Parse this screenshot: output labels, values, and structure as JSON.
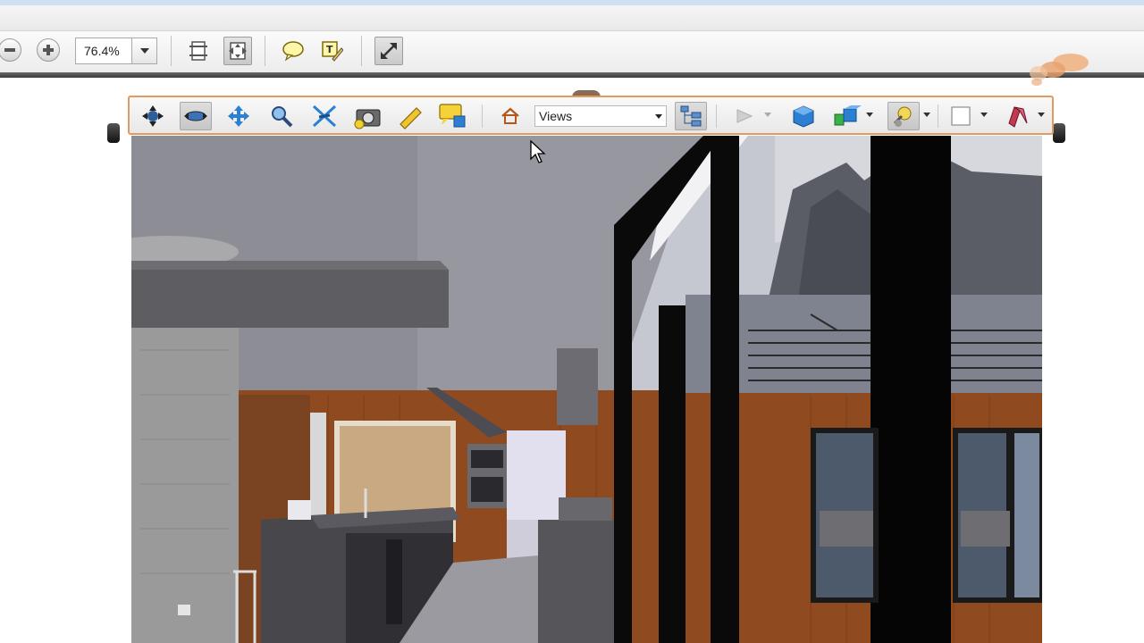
{
  "toolbar": {
    "zoom_value": "76.4%",
    "zoom_out_icon": "zoom-out-icon",
    "zoom_in_icon": "zoom-in-icon",
    "fit_page_icon": "fit-page-icon",
    "fit_width_icon": "fit-width-icon",
    "comment_icon": "sticky-note-icon",
    "highlight_icon": "highlight-text-icon",
    "fullscreen_icon": "fullscreen-icon"
  },
  "toolbar3d": {
    "tools": [
      "rotate-tool-icon",
      "spin-tool-icon",
      "pan-tool-icon",
      "zoom-tool-icon",
      "fly-tool-icon",
      "camera-properties-icon",
      "measure-tool-icon",
      "comment-3d-icon",
      "default-view-icon",
      "model-tree-icon",
      "play-animation-icon",
      "projection-icon",
      "render-mode-icon",
      "lighting-icon",
      "background-color-icon",
      "cross-section-icon"
    ],
    "views_label": "Views"
  },
  "colors": {
    "toolbar_border": "#e29a5e",
    "wood": "#8f4a20",
    "ceiling": "#8e8e96",
    "sky": "#b7bcc7",
    "accent_blue": "#2c7fd1"
  }
}
